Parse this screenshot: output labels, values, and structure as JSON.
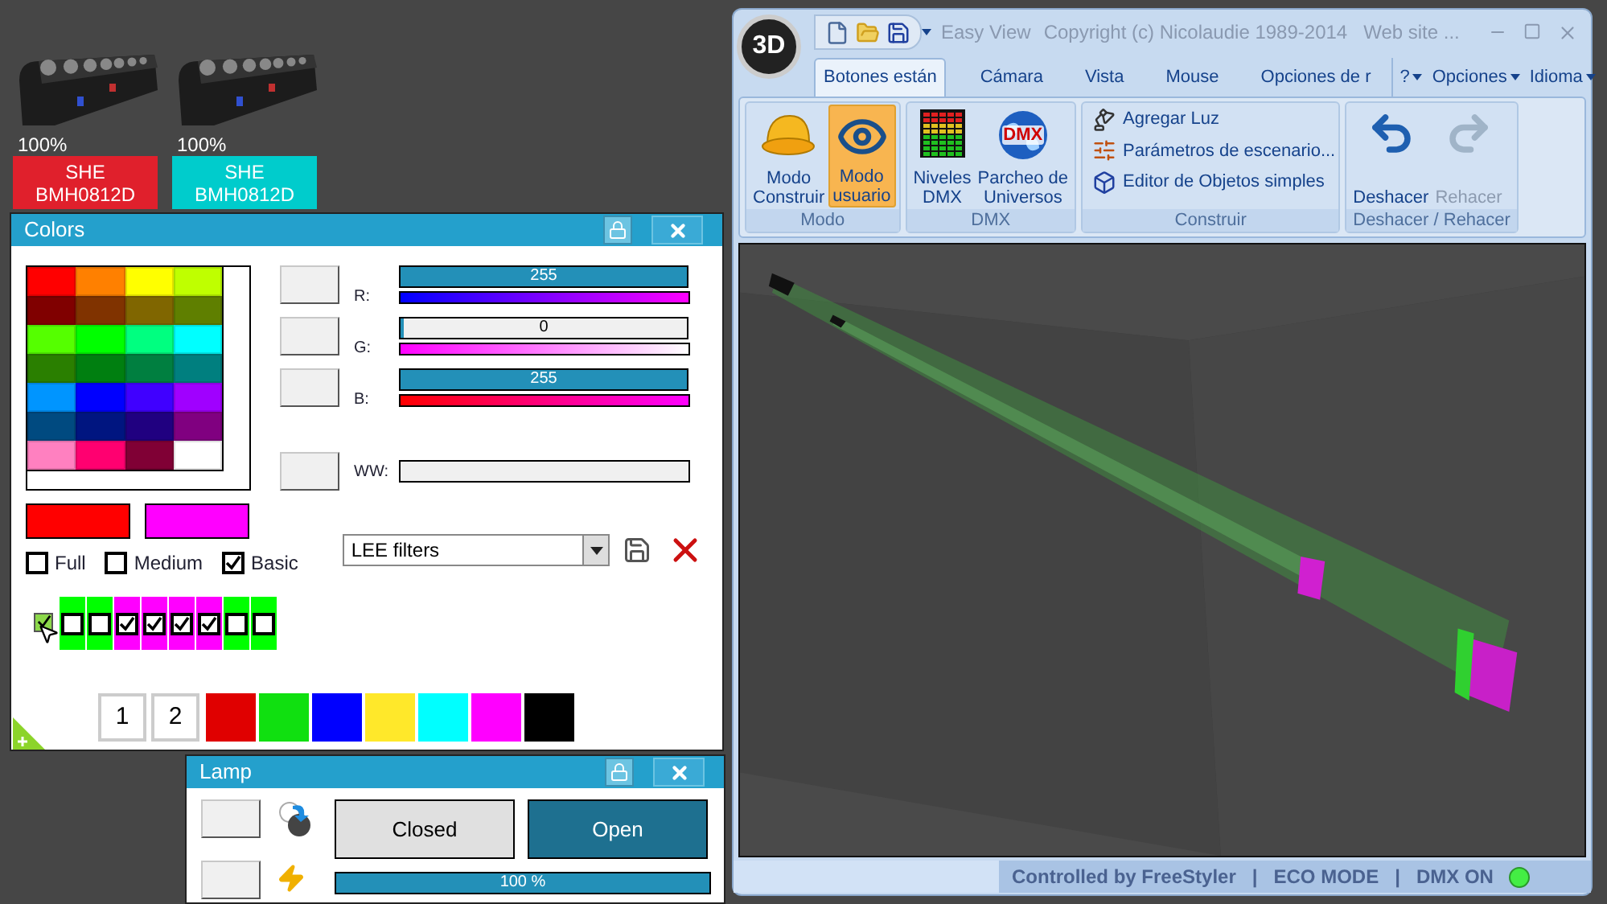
{
  "fixtures": [
    {
      "level_text": "100%",
      "name_lines": [
        "SHE",
        "BMH0812D"
      ],
      "color": "#e0202c"
    },
    {
      "level_text": "100%",
      "name_lines": [
        "SHE",
        "BMH0812D"
      ],
      "color": "#00cccc"
    }
  ],
  "colors_panel": {
    "title": "Colors",
    "palette": [
      {
        "color": "#ff0000"
      },
      {
        "color": "#ff8000"
      },
      {
        "color": "#ffff00"
      },
      {
        "color": "#bfff00"
      },
      {
        "color": "#800000"
      },
      {
        "color": "#803300"
      },
      {
        "color": "#806600"
      },
      {
        "color": "#5f7f00"
      },
      {
        "color": "#55ff00"
      },
      {
        "color": "#00ff00"
      },
      {
        "color": "#00ff80"
      },
      {
        "color": "#00ffff"
      },
      {
        "color": "#2a7f00"
      },
      {
        "color": "#007f10"
      },
      {
        "color": "#007f40"
      },
      {
        "color": "#007f7f"
      },
      {
        "color": "#0095ff"
      },
      {
        "color": "#0000ff"
      },
      {
        "color": "#4000ff"
      },
      {
        "color": "#a000ff"
      },
      {
        "color": "#004a80"
      },
      {
        "color": "#001580"
      },
      {
        "color": "#200080"
      },
      {
        "color": "#800080"
      },
      {
        "color": "#ff80c0"
      },
      {
        "color": "#ff0070"
      },
      {
        "color": "#800035"
      },
      {
        "color": "#ffffff"
      }
    ],
    "channels": [
      {
        "label": "R:",
        "value": "255",
        "level": 1
      },
      {
        "label": "G:",
        "value": "0",
        "level": 0
      },
      {
        "label": "B:",
        "value": "255",
        "level": 1
      }
    ],
    "ww": {
      "label": "WW:",
      "level": 0
    },
    "current_colors": [
      {
        "color": "#ff0000"
      },
      {
        "color": "#ff00ff"
      }
    ],
    "modes": [
      {
        "label": "Full",
        "checked": false
      },
      {
        "label": "Medium",
        "checked": false
      },
      {
        "label": "Basic",
        "checked": true
      }
    ],
    "filter_dropdown": {
      "value": "LEE filters"
    },
    "master_toggle": {
      "checked": true
    },
    "channel_toggles": [
      {
        "checked": false,
        "color": "#00ff00"
      },
      {
        "checked": false,
        "color": "#00ff00"
      },
      {
        "checked": true,
        "color": "#ff00ff"
      },
      {
        "checked": true,
        "color": "#ff00ff"
      },
      {
        "checked": true,
        "color": "#ff00ff"
      },
      {
        "checked": true,
        "color": "#ff00ff"
      },
      {
        "checked": false,
        "color": "#00ff00"
      },
      {
        "checked": false,
        "color": "#00ff00"
      }
    ],
    "pages": [
      "1",
      "2"
    ],
    "presets": [
      {
        "color": "#e00000"
      },
      {
        "color": "#10e010"
      },
      {
        "color": "#0000ff"
      },
      {
        "color": "#ffe82a"
      },
      {
        "color": "#00ffff"
      },
      {
        "color": "#ff00ff"
      },
      {
        "color": "#000000"
      }
    ]
  },
  "lamp_panel": {
    "title": "Lamp",
    "shutter": [
      {
        "label": "Closed",
        "selected": false
      },
      {
        "label": "Open",
        "selected": true
      }
    ],
    "dimmer": {
      "value": "100 %",
      "level": 1
    }
  },
  "window": {
    "logo": "3D",
    "title_parts": [
      "Easy View",
      "Copyright (c) Nicolaudie 1989-2014",
      "Web site ..."
    ],
    "tabs": [
      {
        "label": "Botones están",
        "selected": true
      },
      {
        "label": "Cámara",
        "selected": false
      },
      {
        "label": "Vista",
        "selected": false
      },
      {
        "label": "Mouse",
        "selected": false
      },
      {
        "label": "Opciones de r",
        "selected": false
      }
    ],
    "menus": [
      "?",
      "Opciones",
      "Idioma"
    ],
    "groups": [
      {
        "label": "Modo",
        "kind": "large",
        "items": [
          {
            "lines": [
              "Modo",
              "Construir"
            ],
            "selected": false,
            "disabled": false
          },
          {
            "lines": [
              "Modo",
              "usuario"
            ],
            "selected": true,
            "disabled": false
          }
        ]
      },
      {
        "label": "DMX",
        "kind": "large",
        "items": [
          {
            "lines": [
              "Niveles",
              "DMX"
            ],
            "selected": false,
            "disabled": false
          },
          {
            "lines": [
              "Parcheo de",
              "Universos"
            ],
            "badge": "DMX",
            "selected": false,
            "disabled": false
          }
        ]
      },
      {
        "label": "Construir",
        "kind": "list",
        "items": [
          {
            "label": "Agregar Luz"
          },
          {
            "label": "Parámetros de escenario..."
          },
          {
            "label": "Editor de Objetos simples"
          }
        ]
      },
      {
        "label": "Deshacer / Rehacer",
        "kind": "large",
        "items": [
          {
            "lines": [
              "Deshacer"
            ],
            "selected": false,
            "disabled": false
          },
          {
            "lines": [
              "Rehacer"
            ],
            "selected": false,
            "disabled": true
          }
        ]
      }
    ],
    "status": [
      "Controlled by FreeStyler",
      "|",
      "ECO MODE",
      "|",
      "DMX ON"
    ],
    "dmx_led": {
      "on": true
    }
  }
}
